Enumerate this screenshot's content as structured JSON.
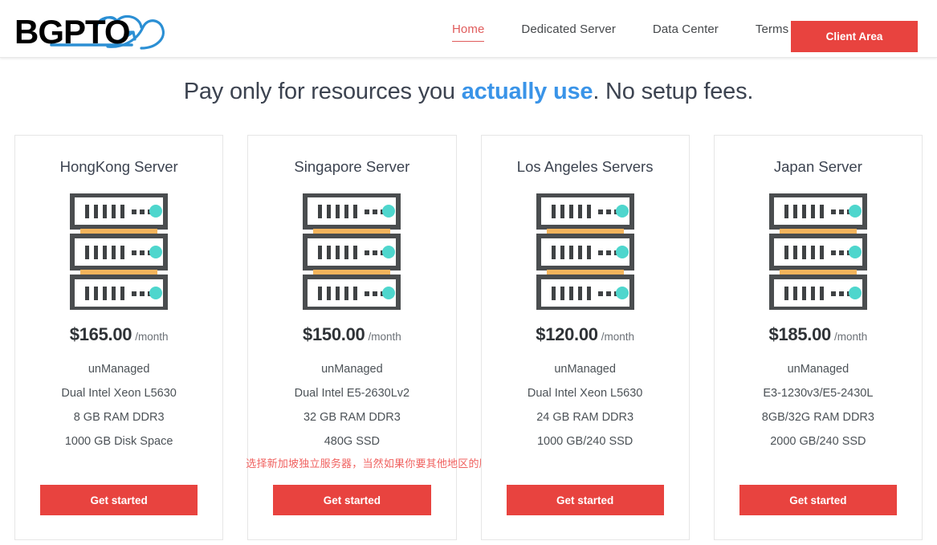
{
  "brand": {
    "logo_text": "BGPTO",
    "logo_color": "#000000",
    "logo_accent_color": "#2b8fd4"
  },
  "nav": {
    "items": [
      {
        "label": "Home",
        "active": true
      },
      {
        "label": "Dedicated Server",
        "active": false
      },
      {
        "label": "Data Center",
        "active": false
      },
      {
        "label": "Terms of use",
        "active": false
      }
    ],
    "cta_label": "Client Area",
    "cta_color": "#e8433f",
    "active_color": "#e05c5c"
  },
  "headline": {
    "before": "Pay only for resources you ",
    "accent": "actually use",
    "after": ". No setup fees.",
    "accent_color": "#3a94e8"
  },
  "annotation": {
    "text": "选择新加坡独立服务器，当然如果你要其他地区的服务器选择其他也可以",
    "color": "#f0615f"
  },
  "cards": [
    {
      "title": "HongKong Server",
      "price": "$165.00",
      "period": "/month",
      "specs": [
        "unManaged",
        "Dual Intel Xeon L5630",
        "8 GB RAM DDR3",
        "1000 GB Disk Space"
      ],
      "cta": "Get started",
      "icon": "server-rack-icon"
    },
    {
      "title": "Singapore Server",
      "price": "$150.00",
      "period": "/month",
      "specs": [
        "unManaged",
        "Dual Intel E5-2630Lv2",
        "32 GB RAM DDR3",
        "480G SSD"
      ],
      "cta": "Get started",
      "icon": "server-rack-icon"
    },
    {
      "title": "Los Angeles Servers",
      "price": "$120.00",
      "period": "/month",
      "specs": [
        "unManaged",
        "Dual Intel Xeon L5630",
        "24 GB RAM DDR3",
        "1000 GB/240 SSD"
      ],
      "cta": "Get started",
      "icon": "server-rack-icon"
    },
    {
      "title": "Japan Server",
      "price": "$185.00",
      "period": "/month",
      "specs": [
        "unManaged",
        "E3-1230v3/E5-2430L",
        "8GB/32G RAM DDR3",
        "2000 GB/240 SSD"
      ],
      "cta": "Get started",
      "icon": "server-rack-icon"
    }
  ],
  "icon_colors": {
    "rack_border": "#4a4d4f",
    "rack_fill": "#ffffff",
    "rack_bars": "#3f4244",
    "rack_led": "#4ed6cd",
    "rack_shelf": "#f4b45c"
  }
}
